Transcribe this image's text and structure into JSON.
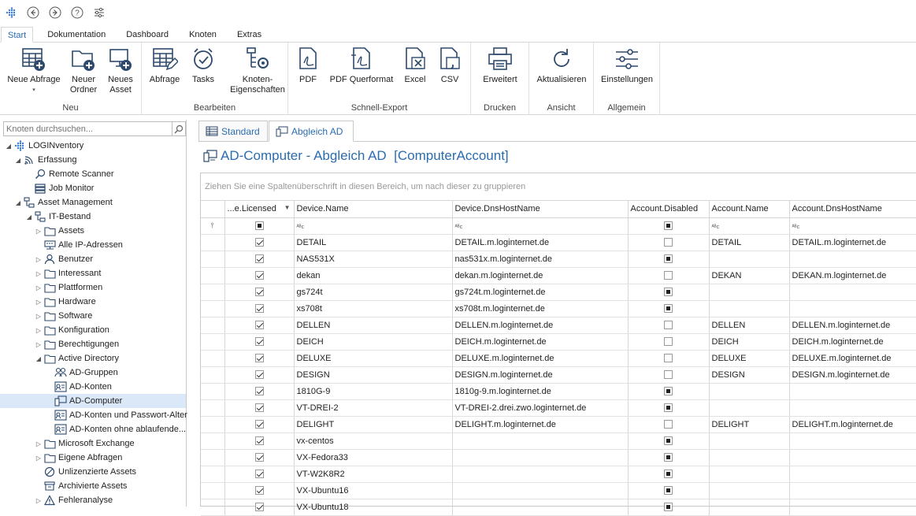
{
  "tabs": [
    "Start",
    "Dokumentation",
    "Dashboard",
    "Knoten",
    "Extras"
  ],
  "ribbon": {
    "groups": [
      {
        "label": "Neu",
        "buttons": [
          "Neue Abfrage",
          "Neuer Ordner",
          "Neues Asset"
        ]
      },
      {
        "label": "Bearbeiten",
        "buttons": [
          "Abfrage",
          "Tasks",
          "Knoten-Eigenschaften"
        ]
      },
      {
        "label": "Schnell-Export",
        "buttons": [
          "PDF",
          "PDF Querformat",
          "Excel",
          "CSV"
        ]
      },
      {
        "label": "Drucken",
        "buttons": [
          "Erweitert"
        ]
      },
      {
        "label": "Ansicht",
        "buttons": [
          "Aktualisieren"
        ]
      },
      {
        "label": "Allgemein",
        "buttons": [
          "Einstellungen"
        ]
      }
    ],
    "neue_abfrage": "Neue Abfrage",
    "neuer_ordner_1": "Neuer",
    "neuer_ordner_2": "Ordner",
    "neues_asset_1": "Neues",
    "neues_asset_2": "Asset",
    "abfrage": "Abfrage",
    "tasks": "Tasks",
    "knoten_1": "Knoten-",
    "knoten_2": "Eigenschaften",
    "pdf": "PDF",
    "pdf_quer": "PDF Querformat",
    "excel": "Excel",
    "csv": "CSV",
    "erweitert": "Erweitert",
    "aktualisieren": "Aktualisieren",
    "einstellungen": "Einstellungen"
  },
  "search": {
    "placeholder": "Knoten durchsuchen..."
  },
  "tree": [
    {
      "label": "LOGINventory",
      "arrow": "◢",
      "icon": "logo"
    },
    {
      "label": "Erfassung",
      "arrow": "◢",
      "icon": "signal"
    },
    {
      "label": "Remote Scanner",
      "arrow": "",
      "icon": "search"
    },
    {
      "label": "Job Monitor",
      "arrow": "",
      "icon": "monitor"
    },
    {
      "label": "Asset Management",
      "arrow": "◢",
      "icon": "net"
    },
    {
      "label": "IT-Bestand",
      "arrow": "◢",
      "icon": "net"
    },
    {
      "label": "Assets",
      "arrow": "▷",
      "icon": "folder"
    },
    {
      "label": "Alle IP-Adressen",
      "arrow": "",
      "icon": "ip"
    },
    {
      "label": "Benutzer",
      "arrow": "▷",
      "icon": "user"
    },
    {
      "label": "Interessant",
      "arrow": "▷",
      "icon": "folder"
    },
    {
      "label": "Plattformen",
      "arrow": "▷",
      "icon": "folder"
    },
    {
      "label": "Hardware",
      "arrow": "▷",
      "icon": "folder"
    },
    {
      "label": "Software",
      "arrow": "▷",
      "icon": "folder"
    },
    {
      "label": "Konfiguration",
      "arrow": "▷",
      "icon": "folder"
    },
    {
      "label": "Berechtigungen",
      "arrow": "▷",
      "icon": "folder"
    },
    {
      "label": "Active Directory",
      "arrow": "◢",
      "icon": "folder"
    },
    {
      "label": "AD-Gruppen",
      "arrow": "",
      "icon": "group"
    },
    {
      "label": "AD-Konten",
      "arrow": "",
      "icon": "card"
    },
    {
      "label": "AD-Computer",
      "arrow": "",
      "icon": "computer",
      "selected": true
    },
    {
      "label": "AD-Konten und Passwort-Alter",
      "arrow": "",
      "icon": "card"
    },
    {
      "label": "AD-Konten ohne ablaufende...",
      "arrow": "",
      "icon": "card"
    },
    {
      "label": "Microsoft Exchange",
      "arrow": "▷",
      "icon": "folder"
    },
    {
      "label": "Eigene Abfragen",
      "arrow": "▷",
      "icon": "folder"
    },
    {
      "label": "Unlizenzierte Assets",
      "arrow": "",
      "icon": "forbid"
    },
    {
      "label": "Archivierte Assets",
      "arrow": "",
      "icon": "archive"
    },
    {
      "label": "Fehleranalyse",
      "arrow": "▷",
      "icon": "warn"
    }
  ],
  "doc_tabs": [
    "Standard",
    "Abgleich AD"
  ],
  "view_title": "AD-Computer - Abgleich AD  [ComputerAccount]",
  "group_hint": "Ziehen Sie eine Spaltenüberschrift in diesen Bereich, um nach dieser zu gruppieren",
  "columns": [
    "...e.Licensed",
    "Device.Name",
    "Device.DnsHostName",
    "Account.Disabled",
    "Account.Name",
    "Account.DnsHostName"
  ],
  "rows": [
    {
      "licensed": true,
      "name": "DETAIL",
      "dns": "DETAIL.m.loginternet.de",
      "disabled": "unchecked",
      "acc": "DETAIL",
      "accdns": "DETAIL.m.loginternet.de"
    },
    {
      "licensed": true,
      "name": "NAS531X",
      "dns": "nas531x.m.loginternet.de",
      "disabled": "null",
      "acc": "",
      "accdns": ""
    },
    {
      "licensed": true,
      "name": "dekan",
      "dns": "dekan.m.loginternet.de",
      "disabled": "unchecked",
      "acc": "DEKAN",
      "accdns": "DEKAN.m.loginternet.de"
    },
    {
      "licensed": true,
      "name": "gs724t",
      "dns": "gs724t.m.loginternet.de",
      "disabled": "null",
      "acc": "",
      "accdns": ""
    },
    {
      "licensed": true,
      "name": "xs708t",
      "dns": "xs708t.m.loginternet.de",
      "disabled": "null",
      "acc": "",
      "accdns": ""
    },
    {
      "licensed": true,
      "name": "DELLEN",
      "dns": "DELLEN.m.loginternet.de",
      "disabled": "unchecked",
      "acc": "DELLEN",
      "accdns": "DELLEN.m.loginternet.de"
    },
    {
      "licensed": true,
      "name": "DEICH",
      "dns": "DEICH.m.loginternet.de",
      "disabled": "unchecked",
      "acc": "DEICH",
      "accdns": "DEICH.m.loginternet.de"
    },
    {
      "licensed": true,
      "name": "DELUXE",
      "dns": "DELUXE.m.loginternet.de",
      "disabled": "unchecked",
      "acc": "DELUXE",
      "accdns": "DELUXE.m.loginternet.de"
    },
    {
      "licensed": true,
      "name": "DESIGN",
      "dns": "DESIGN.m.loginternet.de",
      "disabled": "unchecked",
      "acc": "DESIGN",
      "accdns": "DESIGN.m.loginternet.de"
    },
    {
      "licensed": true,
      "name": "1810G-9",
      "dns": "1810g-9.m.loginternet.de",
      "disabled": "null",
      "acc": "",
      "accdns": ""
    },
    {
      "licensed": true,
      "name": "VT-DREI-2",
      "dns": "VT-DREI-2.drei.zwo.loginternet.de",
      "disabled": "null",
      "acc": "",
      "accdns": ""
    },
    {
      "licensed": true,
      "name": "DELIGHT",
      "dns": "DELIGHT.m.loginternet.de",
      "disabled": "unchecked",
      "acc": "DELIGHT",
      "accdns": "DELIGHT.m.loginternet.de"
    },
    {
      "licensed": true,
      "name": "vx-centos",
      "dns": "",
      "disabled": "null",
      "acc": "",
      "accdns": ""
    },
    {
      "licensed": true,
      "name": "VX-Fedora33",
      "dns": "",
      "disabled": "null",
      "acc": "",
      "accdns": ""
    },
    {
      "licensed": true,
      "name": "VT-W2K8R2",
      "dns": "",
      "disabled": "null",
      "acc": "",
      "accdns": ""
    },
    {
      "licensed": true,
      "name": "VX-Ubuntu16",
      "dns": "",
      "disabled": "null",
      "acc": "",
      "accdns": ""
    },
    {
      "licensed": true,
      "name": "VX-Ubuntu18",
      "dns": "",
      "disabled": "null",
      "acc": "",
      "accdns": ""
    }
  ],
  "colors": {
    "accent": "#2b6cb0",
    "selected": "#dbe8f8"
  }
}
